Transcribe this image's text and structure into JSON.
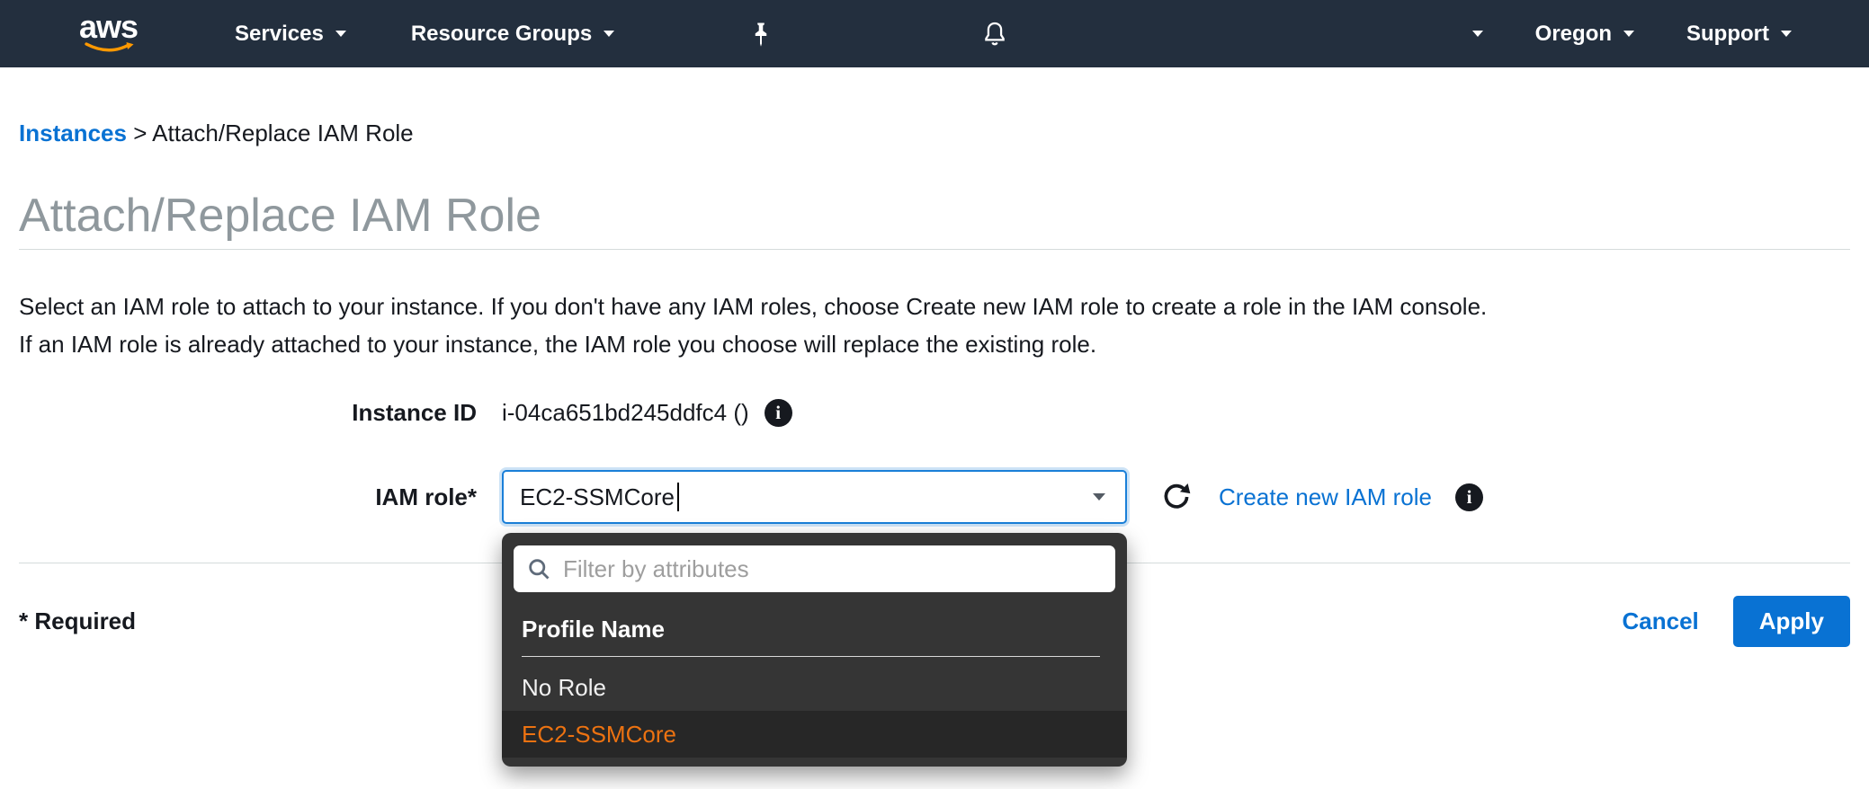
{
  "nav": {
    "logo_text": "aws",
    "services": "Services",
    "resource_groups": "Resource Groups",
    "region": "Oregon",
    "support": "Support"
  },
  "breadcrumb": {
    "parent": "Instances",
    "separator": ">",
    "current": "Attach/Replace IAM Role"
  },
  "page": {
    "title": "Attach/Replace IAM Role",
    "description_line1": "Select an IAM role to attach to your instance. If you don't have any IAM roles, choose Create new IAM role to create a role in the IAM console.",
    "description_line2": "If an IAM role is already attached to your instance, the IAM role you choose will replace the existing role."
  },
  "form": {
    "instance_id_label": "Instance ID",
    "instance_id_value": "i-04ca651bd245ddfc4 ()",
    "iam_role_label": "IAM role*",
    "iam_role_value": "EC2-SSMCore",
    "create_new_role_link": "Create new IAM role"
  },
  "dropdown": {
    "filter_placeholder": "Filter by attributes",
    "column_header": "Profile Name",
    "options": [
      {
        "label": "No Role",
        "selected": false
      },
      {
        "label": "EC2-SSMCore",
        "selected": true
      }
    ]
  },
  "footer": {
    "required_note": "* Required",
    "cancel": "Cancel",
    "apply": "Apply"
  },
  "colors": {
    "nav_bg": "#232f3e",
    "aws_orange": "#ff9900",
    "link_blue": "#0972d3",
    "selected_option_orange": "#ec7211",
    "apply_button_bg": "#0972d3",
    "title_gray": "#8f989d",
    "dropdown_panel_bg": "#353535"
  }
}
